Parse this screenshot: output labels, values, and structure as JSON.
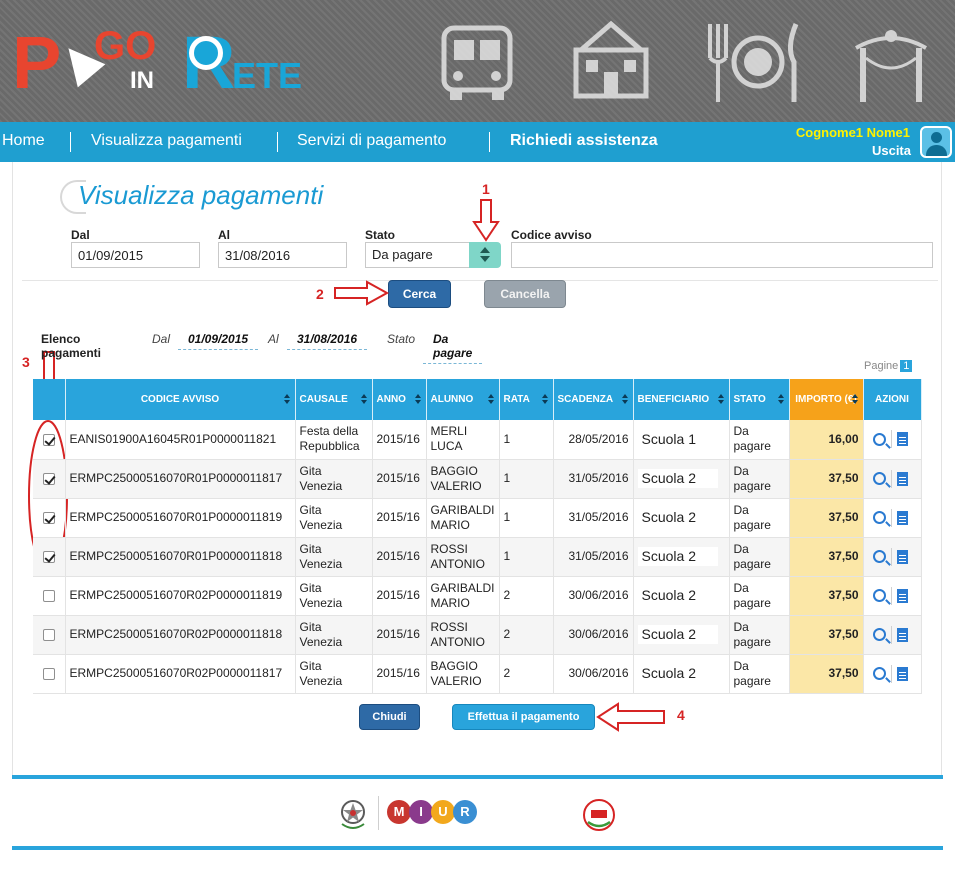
{
  "header": {
    "logo": {
      "p": "P",
      "go": "GO",
      "in": "IN",
      "r": "R",
      "ete": "ETE"
    }
  },
  "nav": {
    "items": [
      "Home",
      "Visualizza pagamenti",
      "Servizi di pagamento",
      "Richiedi assistenza"
    ],
    "user_name": "Cognome1 Nome1",
    "logout": "Uscita"
  },
  "page": {
    "title": "Visualizza pagamenti"
  },
  "filters": {
    "dal_label": "Dal",
    "dal_value": "01/09/2015",
    "al_label": "Al",
    "al_value": "31/08/2016",
    "stato_label": "Stato",
    "stato_value": "Da pagare",
    "codice_label": "Codice avviso",
    "codice_value": ""
  },
  "buttons": {
    "cerca": "Cerca",
    "cancella": "Cancella",
    "chiudi": "Chiudi",
    "effettua": "Effettua il pagamento"
  },
  "annotations": {
    "a1": "1",
    "a2": "2",
    "a3": "3",
    "a4": "4"
  },
  "summary": {
    "label": "Elenco pagamenti",
    "dal_k": "Dal",
    "dal_v": "01/09/2015",
    "al_k": "Al",
    "al_v": "31/08/2016",
    "stato_k": "Stato",
    "stato_v": "Da pagare"
  },
  "pagination": {
    "label": "Pagine",
    "current": "1"
  },
  "table": {
    "headers": [
      "CODICE AVVISO",
      "CAUSALE",
      "ANNO",
      "ALUNNO",
      "RATA",
      "SCADENZA",
      "BENEFICIARIO",
      "STATO",
      "IMPORTO (€)",
      "AZIONI"
    ],
    "rows": [
      {
        "checked": true,
        "codice": "EANIS01900A16045R01P0000011821",
        "causale": "Festa della Repubblica",
        "anno": "2015/16",
        "alunno": "MERLI LUCA",
        "rata": "1",
        "scadenza": "28/05/2016",
        "beneficiario": "Scuola 1",
        "stato": "Da pagare",
        "importo": "16,00"
      },
      {
        "checked": true,
        "codice": "ERMPC25000516070R01P0000011817",
        "causale": "Gita Venezia",
        "anno": "2015/16",
        "alunno": "BAGGIO VALERIO",
        "rata": "1",
        "scadenza": "31/05/2016",
        "beneficiario": "Scuola 2",
        "stato": "Da pagare",
        "importo": "37,50"
      },
      {
        "checked": true,
        "codice": "ERMPC25000516070R01P0000011819",
        "causale": "Gita Venezia",
        "anno": "2015/16",
        "alunno": "GARIBALDI MARIO",
        "rata": "1",
        "scadenza": "31/05/2016",
        "beneficiario": "Scuola 2",
        "stato": "Da pagare",
        "importo": "37,50"
      },
      {
        "checked": true,
        "codice": "ERMPC25000516070R01P0000011818",
        "causale": "Gita Venezia",
        "anno": "2015/16",
        "alunno": "ROSSI ANTONIO",
        "rata": "1",
        "scadenza": "31/05/2016",
        "beneficiario": "Scuola 2",
        "stato": "Da pagare",
        "importo": "37,50"
      },
      {
        "checked": false,
        "codice": "ERMPC25000516070R02P0000011819",
        "causale": "Gita Venezia",
        "anno": "2015/16",
        "alunno": "GARIBALDI MARIO",
        "rata": "2",
        "scadenza": "30/06/2016",
        "beneficiario": "Scuola 2",
        "stato": "Da pagare",
        "importo": "37,50"
      },
      {
        "checked": false,
        "codice": "ERMPC25000516070R02P0000011818",
        "causale": "Gita Venezia",
        "anno": "2015/16",
        "alunno": "ROSSI ANTONIO",
        "rata": "2",
        "scadenza": "30/06/2016",
        "beneficiario": "Scuola 2",
        "stato": "Da pagare",
        "importo": "37,50"
      },
      {
        "checked": false,
        "codice": "ERMPC25000516070R02P0000011817",
        "causale": "Gita Venezia",
        "anno": "2015/16",
        "alunno": "BAGGIO VALERIO",
        "rata": "2",
        "scadenza": "30/06/2016",
        "beneficiario": "Scuola 2",
        "stato": "Da pagare",
        "importo": "37,50"
      }
    ]
  },
  "footer": {
    "miur": [
      "M",
      "I",
      "U",
      "R"
    ]
  },
  "colors": {
    "brand_blue": "#29a4dc",
    "nav_blue": "#1f9fd0",
    "accent_orange": "#f6a21a",
    "annotation_red": "#d62424"
  }
}
